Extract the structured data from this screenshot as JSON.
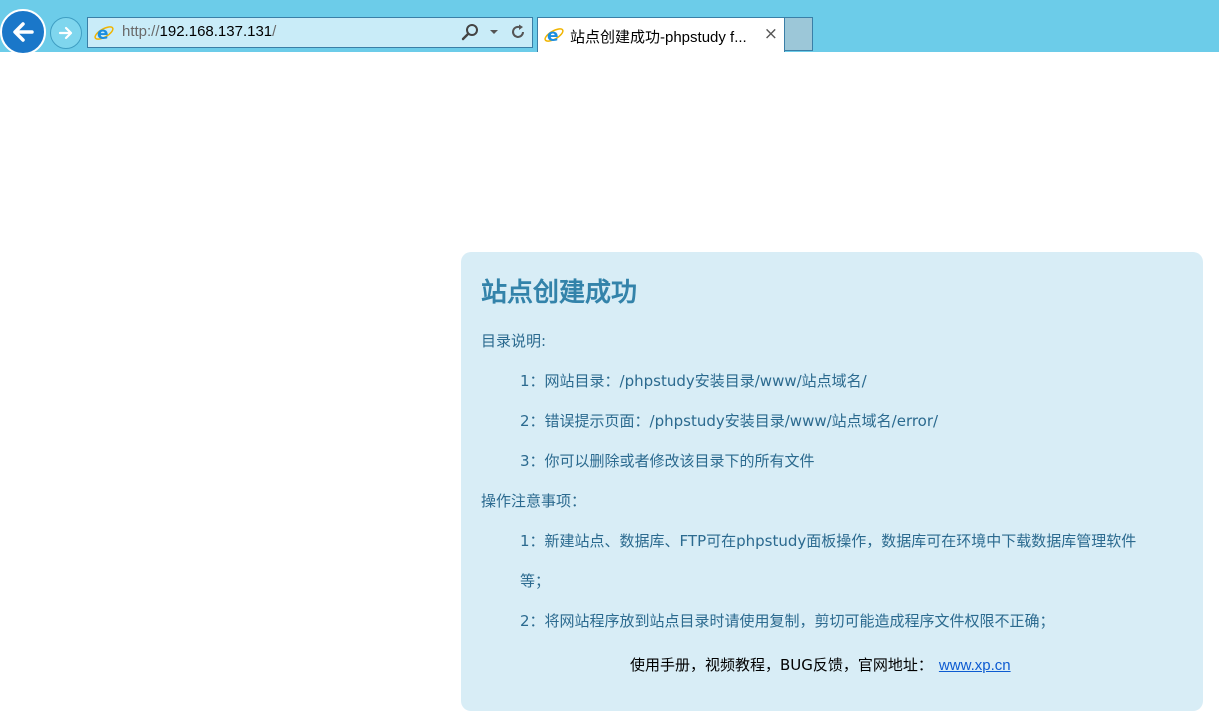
{
  "browser": {
    "url_protocol": "http://",
    "url_host": "192.168.137.131",
    "url_suffix": "/",
    "tab_title": "站点创建成功-phpstudy f...",
    "tab_close": "×"
  },
  "page": {
    "title": "站点创建成功",
    "dir_heading": "目录说明:",
    "dir_items": [
      "1：网站目录：/phpstudy安装目录/www/站点域名/",
      "2：错误提示页面：/phpstudy安装目录/www/站点域名/error/",
      "3：你可以删除或者修改该目录下的所有文件"
    ],
    "notes_heading": "操作注意事项：",
    "notes_items": [
      "1：新建站点、数据库、FTP可在phpstudy面板操作，数据库可在环境中下载数据库管理软件",
      "等；",
      "2：将网站程序放到站点目录时请使用复制，剪切可能造成程序文件权限不正确；"
    ],
    "footer_text": "使用手册，视频教程，BUG反馈，官网地址：",
    "footer_link": "www.xp.cn"
  },
  "colors": {
    "chrome": "#6ccce9",
    "panel": "#d8edf6",
    "title": "#3383aa",
    "text": "#2b6a8f",
    "link": "#0d5bd1"
  },
  "icons": [
    "back-arrow-icon",
    "forward-arrow-icon",
    "ie-logo-icon",
    "search-icon",
    "dropdown-icon",
    "refresh-icon",
    "close-icon"
  ]
}
